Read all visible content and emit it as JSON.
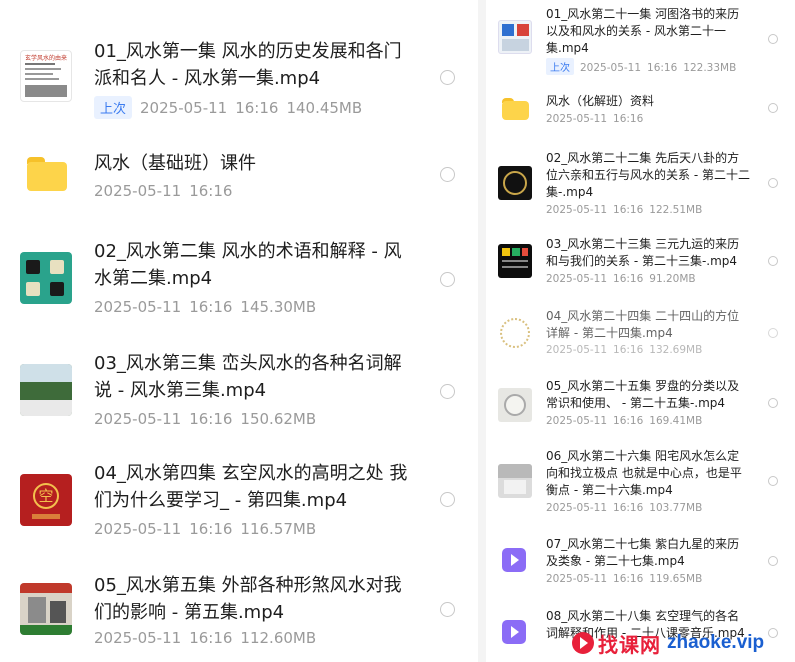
{
  "left_list": {
    "items": [
      {
        "kind": "video",
        "title": "01_风水第一集 风水的历史发展和各门派和名人 - 风水第一集.mp4",
        "badge": "上次",
        "date": "2025-05-11",
        "time": "16:16",
        "size": "140.45MB",
        "thumb_text": "玄学风水的由来"
      },
      {
        "kind": "folder",
        "title": "风水（基础班）课件",
        "date": "2025-05-11",
        "time": "16:16"
      },
      {
        "kind": "video",
        "title": "02_风水第二集 风水的术语和解释 - 风水第二集.mp4",
        "date": "2025-05-11",
        "time": "16:16",
        "size": "145.30MB"
      },
      {
        "kind": "video",
        "title": "03_风水第三集 峦头风水的各种名词解说 - 风水第三集.mp4",
        "date": "2025-05-11",
        "time": "16:16",
        "size": "150.62MB"
      },
      {
        "kind": "video",
        "title": "04_风水第四集 玄空风水的高明之处 我们为什么要学习_ - 第四集.mp4",
        "date": "2025-05-11",
        "time": "16:16",
        "size": "116.57MB",
        "thumb_text": "空"
      },
      {
        "kind": "video",
        "title": "05_风水第五集 外部各种形煞风水对我们的影响 - 第五集.mp4",
        "date": "2025-05-11",
        "time": "16:16",
        "size": "112.60MB"
      }
    ]
  },
  "right_list": {
    "items": [
      {
        "kind": "video",
        "title": "01_风水第二十一集 河图洛书的来历以及和风水的关系 - 风水第二十一集.mp4",
        "badge": "上次",
        "date": "2025-05-11",
        "time": "16:16",
        "size": "122.33MB"
      },
      {
        "kind": "folder",
        "title": "风水（化解班）资料",
        "date": "2025-05-11",
        "time": "16:16"
      },
      {
        "kind": "video",
        "title": "02_风水第二十二集 先后天八卦的方位六亲和五行与风水的关系 - 第二十二集-.mp4",
        "date": "2025-05-11",
        "time": "16:16",
        "size": "122.51MB"
      },
      {
        "kind": "video",
        "title": "03_风水第二十三集 三元九运的来历和与我们的关系 - 第二十三集-.mp4",
        "date": "2025-05-11",
        "time": "16:16",
        "size": "91.20MB"
      },
      {
        "kind": "video",
        "title": "04_风水第二十四集 二十四山的方位详解 - 第二十四集.mp4",
        "date": "2025-05-11",
        "time": "16:16",
        "size": "132.69MB"
      },
      {
        "kind": "video",
        "title": "05_风水第二十五集 罗盘的分类以及常识和使用、 - 第二十五集-.mp4",
        "date": "2025-05-11",
        "time": "16:16",
        "size": "169.41MB"
      },
      {
        "kind": "video",
        "title": "06_风水第二十六集 阳宅风水怎么定向和找立极点 也就是中心点，也是平衡点 - 第二十六集.mp4",
        "date": "2025-05-11",
        "time": "16:16",
        "size": "103.77MB"
      },
      {
        "kind": "video",
        "title": "07_风水第二十七集 紫白九星的来历及类象 - 第二十七集.mp4",
        "date": "2025-05-11",
        "time": "16:16",
        "size": "119.65MB"
      },
      {
        "kind": "video",
        "title": "08_风水第二十八集 玄空理气的各名词解释和作用 - 二十八课零音乐.mp4",
        "date": "",
        "time": "",
        "size": ""
      }
    ]
  },
  "watermark": {
    "brand": "找课网",
    "url": "zhaoke.vip"
  },
  "colors": {
    "accent": "#3a7bf0",
    "folder": "#fdd44a",
    "video_icon": "#8b6cf6",
    "watermark_red": "#e8203a",
    "watermark_blue": "#1a5fd0"
  }
}
